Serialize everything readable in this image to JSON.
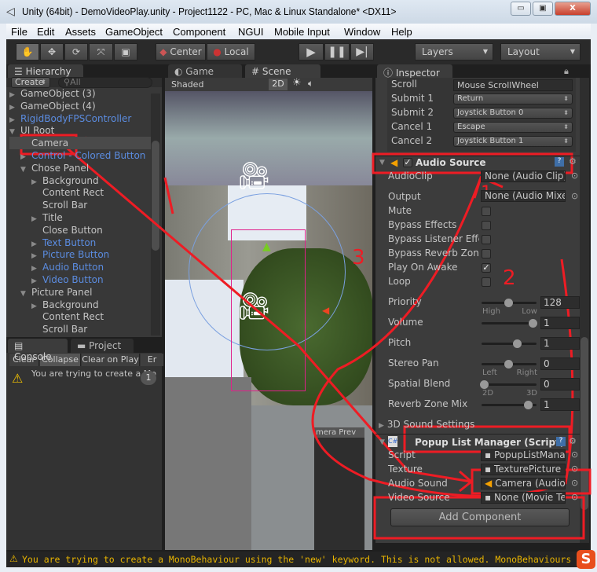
{
  "window": {
    "title": "Unity (64bit) - DemoVideoPlay.unity - Project1122 - PC, Mac & Linux Standalone* <DX11>",
    "minimize": "▭",
    "restore": "▣",
    "close": "X"
  },
  "menu": [
    "File",
    "Edit",
    "Assets",
    "GameObject",
    "Component",
    "NGUI",
    "Mobile Input",
    "Window",
    "Help"
  ],
  "toolbar": {
    "center": "Center",
    "local": "Local",
    "layers": "Layers",
    "layout": "Layout"
  },
  "hierarchy": {
    "tab": "Hierarchy",
    "create": "Create",
    "search_placeholder": "All",
    "items": [
      {
        "label": "GameObject (3)",
        "depth": 0,
        "arrow": "▶",
        "prefab": false
      },
      {
        "label": "GameObject (4)",
        "depth": 0,
        "arrow": "▶",
        "prefab": false
      },
      {
        "label": "RigidBodyFPSController",
        "depth": 0,
        "arrow": "▶",
        "prefab": true
      },
      {
        "label": "UI Root",
        "depth": 0,
        "arrow": "▼",
        "prefab": false
      },
      {
        "label": "Camera",
        "depth": 1,
        "arrow": "",
        "prefab": false,
        "selected": true
      },
      {
        "label": "Control - Colored Button",
        "depth": 1,
        "arrow": "▶",
        "prefab": true
      },
      {
        "label": "Chose Panel",
        "depth": 1,
        "arrow": "▼",
        "prefab": false
      },
      {
        "label": "Background",
        "depth": 2,
        "arrow": "▶",
        "prefab": false
      },
      {
        "label": "Content Rect",
        "depth": 2,
        "arrow": "",
        "prefab": false
      },
      {
        "label": "Scroll Bar",
        "depth": 2,
        "arrow": "",
        "prefab": false
      },
      {
        "label": "Title",
        "depth": 2,
        "arrow": "▶",
        "prefab": false
      },
      {
        "label": "Close Button",
        "depth": 2,
        "arrow": "",
        "prefab": false
      },
      {
        "label": "Text Button",
        "depth": 2,
        "arrow": "▶",
        "prefab": true
      },
      {
        "label": "Picture Button",
        "depth": 2,
        "arrow": "▶",
        "prefab": true
      },
      {
        "label": "Audio Button",
        "depth": 2,
        "arrow": "▶",
        "prefab": true
      },
      {
        "label": "Video Button",
        "depth": 2,
        "arrow": "▶",
        "prefab": true
      },
      {
        "label": "Picture Panel",
        "depth": 1,
        "arrow": "▼",
        "prefab": false
      },
      {
        "label": "Background",
        "depth": 2,
        "arrow": "▶",
        "prefab": false
      },
      {
        "label": "Content Rect",
        "depth": 2,
        "arrow": "",
        "prefab": false
      },
      {
        "label": "Scroll Bar",
        "depth": 2,
        "arrow": "",
        "prefab": false
      }
    ]
  },
  "console": {
    "tab": "Console",
    "project_tab": "Project",
    "buttons": [
      "Clear",
      "Collapse",
      "Clear on Play",
      "Er"
    ],
    "message": "You are trying to create a Mo",
    "count": "1"
  },
  "scene": {
    "game_tab": "Game",
    "scene_tab": "Scene",
    "shading": "Shaded",
    "mode_2d": "2D",
    "camera_preview": "mera Prev"
  },
  "inspector": {
    "tab": "Inspector",
    "input_rows": [
      {
        "label": "Scroll",
        "value": "Mouse ScrollWheel",
        "type": "text"
      },
      {
        "label": "Submit 1",
        "value": "Return",
        "type": "popup"
      },
      {
        "label": "Submit 2",
        "value": "Joystick Button 0",
        "type": "popup"
      },
      {
        "label": "Cancel 1",
        "value": "Escape",
        "type": "popup"
      },
      {
        "label": "Cancel 2",
        "value": "Joystick Button 1",
        "type": "popup"
      }
    ],
    "audio_source": {
      "title": "Audio Source",
      "enabled": true,
      "audioclip_label": "AudioClip",
      "audioclip": "None (Audio Clip)",
      "output_label": "Output",
      "output": "None (Audio Mixer",
      "toggles": [
        {
          "label": "Mute",
          "checked": false
        },
        {
          "label": "Bypass Effects",
          "checked": false
        },
        {
          "label": "Bypass Listener Effe",
          "checked": false
        },
        {
          "label": "Bypass Reverb Zone",
          "checked": false
        },
        {
          "label": "Play On Awake",
          "checked": true
        },
        {
          "label": "Loop",
          "checked": false
        }
      ],
      "sliders": [
        {
          "label": "Priority",
          "value": "128",
          "fraction": 0.5,
          "min_label": "High",
          "max_label": "Low"
        },
        {
          "label": "Volume",
          "value": "1",
          "fraction": 1
        },
        {
          "label": "Pitch",
          "value": "1",
          "fraction": 0.67
        },
        {
          "label": "Stereo Pan",
          "value": "0",
          "fraction": 0.5,
          "min_label": "Left",
          "max_label": "Right"
        },
        {
          "label": "Spatial Blend",
          "value": "0",
          "fraction": 0,
          "min_label": "2D",
          "max_label": "3D"
        },
        {
          "label": "Reverb Zone Mix",
          "value": "1",
          "fraction": 0.9
        }
      ],
      "sound_settings": "3D Sound Settings"
    },
    "popup_list": {
      "title": "Popup List Manager (Script)",
      "rows": [
        {
          "label": "Script",
          "value": "PopupListManag"
        },
        {
          "label": "Texture",
          "value": "TexturePicture ("
        },
        {
          "label": "Audio Sound",
          "value": "Camera (Audio"
        },
        {
          "label": "Video Source",
          "value": "None (Movie Text"
        }
      ]
    },
    "add_component": "Add Component"
  },
  "status": {
    "message": "You are trying to create a MonoBehaviour using the 'new' keyword.  This is not allowed.  MonoBehaviours can only be adde",
    "color": "#e8b400"
  },
  "annotations": {
    "labels": [
      "1",
      "2",
      "3"
    ],
    "color": "#ee1c24"
  }
}
